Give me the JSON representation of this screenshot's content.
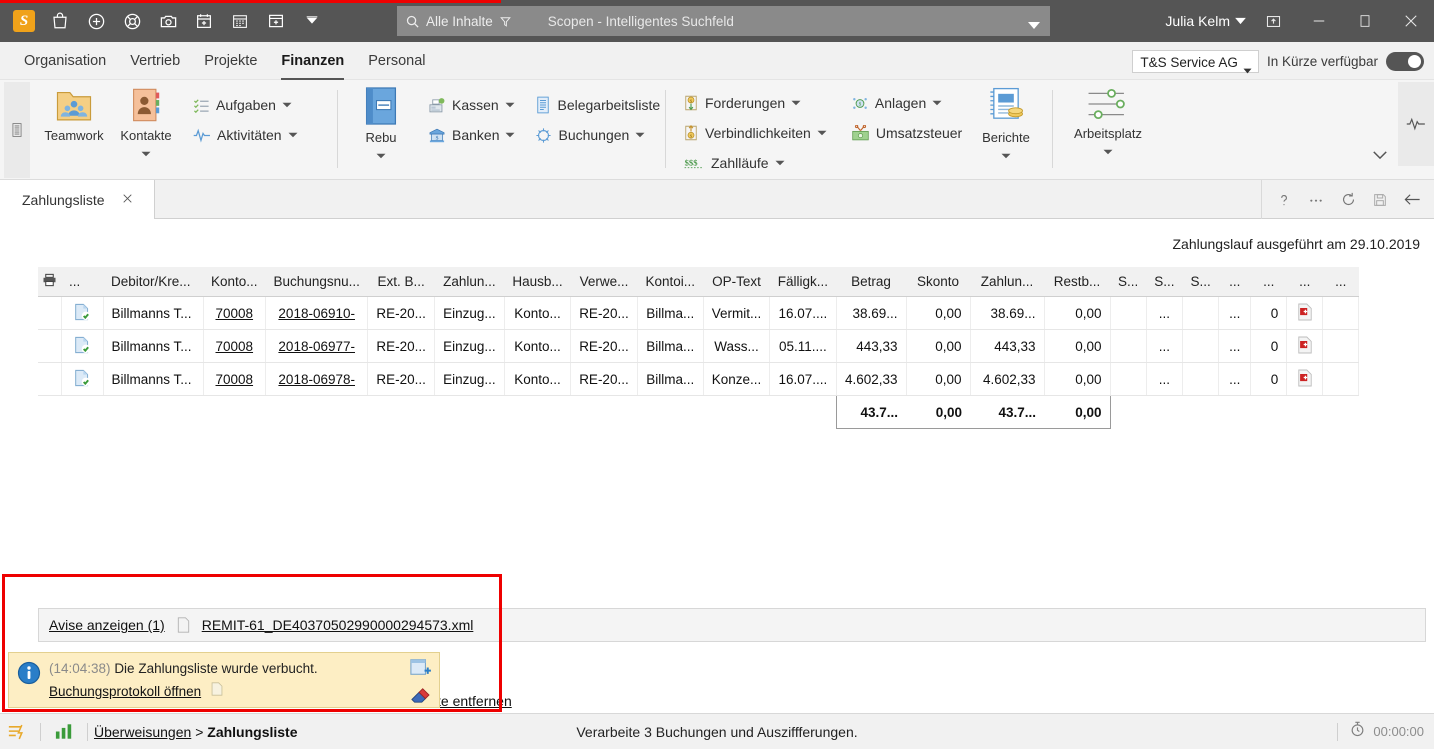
{
  "titlebar": {
    "logo": "S",
    "quick_icons": [
      "shopping-bag-icon",
      "plus-circle-icon",
      "lifebuoy-icon",
      "camera-icon",
      "calendar-add-icon",
      "calendar-icon",
      "window-add-icon",
      "overflow-caret-icon"
    ],
    "search_scope": "Alle Inhalte",
    "search_placeholder": "Scopen - Intelligentes Suchfeld",
    "user_name": "Julia Kelm",
    "window_buttons": [
      "restore-panel-icon",
      "minimize-icon",
      "maximize-icon",
      "close-icon"
    ]
  },
  "menubar": {
    "items": [
      {
        "label": "Organisation",
        "active": false
      },
      {
        "label": "Vertrieb",
        "active": false
      },
      {
        "label": "Projekte",
        "active": false
      },
      {
        "label": "Finanzen",
        "active": true
      },
      {
        "label": "Personal",
        "active": false
      }
    ],
    "company": "T&S Service AG",
    "toggle_label": "In Kürze verfügbar"
  },
  "ribbon": {
    "group1": [
      {
        "label": "Teamwork",
        "icon": "teamwork-folder-icon",
        "dropdown": false
      },
      {
        "label": "Kontakte",
        "icon": "contacts-book-icon",
        "dropdown": true
      }
    ],
    "group1_small": [
      {
        "label": "Aufgaben",
        "icon": "tasks-icon",
        "dropdown": true
      },
      {
        "label": "Aktivitäten",
        "icon": "activity-pulse-icon",
        "dropdown": true
      }
    ],
    "group2_big": {
      "label": "Rebu",
      "icon": "rebu-book-icon",
      "dropdown": true
    },
    "group2_small": [
      {
        "label": "Kassen",
        "icon": "cash-register-icon",
        "dropdown": true
      },
      {
        "label": "Banken",
        "icon": "bank-icon",
        "dropdown": true
      },
      {
        "label": "Belegarbeitsliste",
        "icon": "document-list-icon",
        "dropdown": false
      },
      {
        "label": "Buchungen",
        "icon": "bookings-icon",
        "dropdown": true
      }
    ],
    "group3_small": [
      {
        "label": "Forderungen",
        "icon": "receivables-icon",
        "dropdown": true
      },
      {
        "label": "Verbindlichkeiten",
        "icon": "payables-icon",
        "dropdown": true
      },
      {
        "label": "Zahlläufe",
        "icon": "payment-runs-icon",
        "dropdown": true
      },
      {
        "label": "Anlagen",
        "icon": "assets-icon",
        "dropdown": true
      },
      {
        "label": "Umsatzsteuer",
        "icon": "vat-icon",
        "dropdown": false
      }
    ],
    "group4_big": {
      "label": "Berichte",
      "icon": "reports-icon",
      "dropdown": true
    },
    "group5_big": {
      "label": "Arbeitsplatz",
      "icon": "workplace-sliders-icon",
      "dropdown": true
    }
  },
  "tabstrip": {
    "tab_label": "Zahlungsliste",
    "tools": [
      "help-icon",
      "more-icon",
      "refresh-icon",
      "save-icon",
      "back-arrow-icon"
    ]
  },
  "content": {
    "run_info": "Zahlungslauf ausgeführt am 29.10.2019",
    "columns": [
      "...",
      "Debitor/Kre...",
      "Konto...",
      "Buchungsnu...",
      "Ext. B...",
      "Zahlun...",
      "Hausb...",
      "Verwe...",
      "Kontoi...",
      "OP-Text",
      "Fälligk...",
      "Betrag",
      "Skonto",
      "Zahlun...",
      "Restb...",
      "S...",
      "S...",
      "S...",
      "...",
      "...",
      "...",
      "..."
    ],
    "rows": [
      {
        "status_icon": "document-check-icon",
        "debitor": "Billmanns T...",
        "konto": "70008",
        "buchungsnummer": "2018-06910-",
        "ext_beleg": "RE-20...",
        "zahlungsart": "Einzug...",
        "hausbank": "Konto...",
        "verwendung": "RE-20...",
        "kontoinhaber": "Billma...",
        "op_text": "Vermit...",
        "faelligkeit": "16.07....",
        "betrag": "38.69...",
        "skonto": "0,00",
        "zahlung": "38.69...",
        "restbetrag": "0,00",
        "s1": "...",
        "s2": "...",
        "s3": "0",
        "pdf_icon": "pdf-document-icon"
      },
      {
        "status_icon": "document-check-icon",
        "debitor": "Billmanns T...",
        "konto": "70008",
        "buchungsnummer": "2018-06977-",
        "ext_beleg": "RE-20...",
        "zahlungsart": "Einzug...",
        "hausbank": "Konto...",
        "verwendung": "RE-20...",
        "kontoinhaber": "Billma...",
        "op_text": "Wass...",
        "faelligkeit": "05.11....",
        "betrag": "443,33",
        "skonto": "0,00",
        "zahlung": "443,33",
        "restbetrag": "0,00",
        "s1": "...",
        "s2": "...",
        "s3": "0",
        "pdf_icon": "pdf-document-icon"
      },
      {
        "status_icon": "document-check-icon",
        "debitor": "Billmanns T...",
        "konto": "70008",
        "buchungsnummer": "2018-06978-",
        "ext_beleg": "RE-20...",
        "zahlungsart": "Einzug...",
        "hausbank": "Konto...",
        "verwendung": "RE-20...",
        "kontoinhaber": "Billma...",
        "op_text": "Konze...",
        "faelligkeit": "16.07....",
        "betrag": "4.602,33",
        "skonto": "0,00",
        "zahlung": "4.602,33",
        "restbetrag": "0,00",
        "s1": "...",
        "s2": "...",
        "s3": "0",
        "pdf_icon": "pdf-document-icon"
      }
    ],
    "totals": {
      "betrag": "43.7...",
      "skonto": "0,00",
      "zahlung": "43.7...",
      "restbetrag": "0,00"
    }
  },
  "avise_bar": {
    "link_label": "Avise anzeigen (1)",
    "file_icon": "file-icon",
    "file_name": "REMIT-61_DE40370502990000294573.xml"
  },
  "toast": {
    "icon": "info-icon",
    "timestamp": "(14:04:38)",
    "message": "Die Zahlungsliste wurde verbucht.",
    "action_link": "Buchungsprotokoll öffnen",
    "copy_icon": "copy-icon",
    "actions": [
      "new-note-icon",
      "eraser-icon"
    ]
  },
  "behind_link": "te entfernen",
  "statusbar": {
    "icons": [
      "lightning-list-icon",
      "bar-chart-icon"
    ],
    "breadcrumb_parent": "Überweisungen",
    "breadcrumb_sep": ">",
    "breadcrumb_current": "Zahlungsliste",
    "center_message": "Verarbeite 3 Buchungen und Ausziffferungen.",
    "timer_icon": "stopwatch-icon",
    "timer": "00:00:00"
  },
  "colors": {
    "titlebar": "#555555",
    "accent_orange": "#f0a21a",
    "highlight_red": "#ee0000",
    "toast_bg": "#fdeec4"
  }
}
